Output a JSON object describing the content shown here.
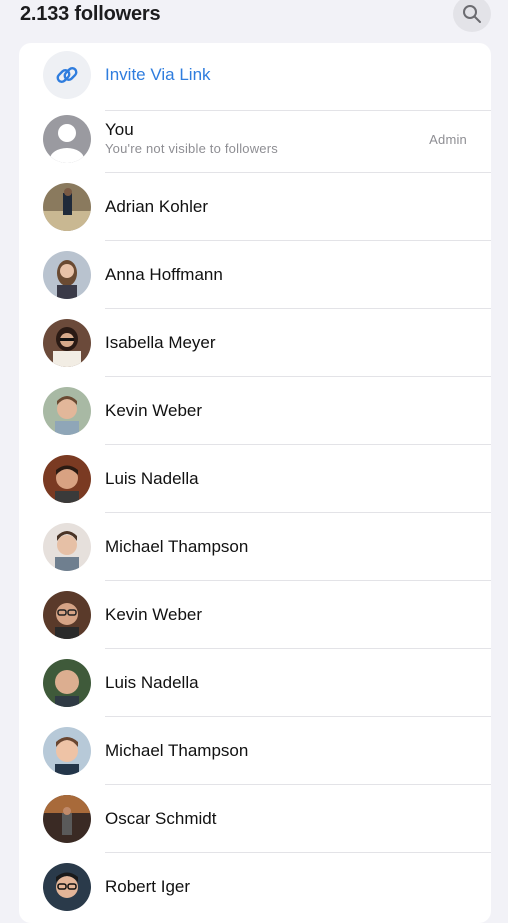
{
  "header": {
    "title": "2.133 followers",
    "search_icon": "search-icon"
  },
  "invite": {
    "label": "Invite Via Link",
    "icon": "link-icon",
    "accent": "#2f7dde"
  },
  "self": {
    "name": "You",
    "subtitle": "You're not visible to followers",
    "role": "Admin"
  },
  "followers": [
    {
      "name": "Adrian Kohler"
    },
    {
      "name": "Anna Hoffmann"
    },
    {
      "name": "Isabella Meyer"
    },
    {
      "name": "Kevin Weber"
    },
    {
      "name": "Luis Nadella"
    },
    {
      "name": "Michael Thampson"
    },
    {
      "name": "Kevin Weber"
    },
    {
      "name": "Luis Nadella"
    },
    {
      "name": "Michael Thampson"
    },
    {
      "name": "Oscar Schmidt"
    },
    {
      "name": "Robert Iger"
    }
  ]
}
